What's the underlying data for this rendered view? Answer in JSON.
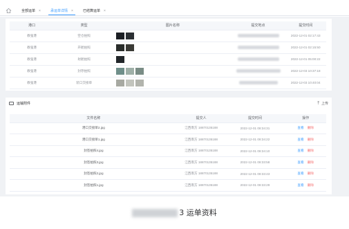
{
  "tabs": [
    {
      "label": "全部运单"
    },
    {
      "label": "承运单详情"
    },
    {
      "label": "已结算运单"
    }
  ],
  "tab_close": "×",
  "table1": {
    "headers": [
      "港口",
      "类型",
      "图片名称",
      "提交地点",
      "提交时间"
    ],
    "rows": [
      {
        "port": "教强港",
        "type": "空仓拍照",
        "thumbs": [
          "#1c1f24",
          "#2b2f33"
        ],
        "time": "2022-12-01 02:17:43"
      },
      {
        "port": "教强港",
        "type": "开舱拍照",
        "thumbs": [
          "#2a2d2b",
          "#3a3a36"
        ],
        "time": "2022-12-01 02:15:50"
      },
      {
        "port": "教强港",
        "type": "射舱拍照",
        "thumbs": [
          "#22262a"
        ],
        "time": "2022-12-01 05:00:22"
      },
      {
        "port": "教强港",
        "type": "封存拍照",
        "thumbs": [
          "#6f8f8a",
          "#9fb0a8",
          "#7a8d86"
        ],
        "time": "2022-12-03 10:37:18"
      },
      {
        "port": "教强港",
        "type": "装口交接单",
        "thumbs": [
          "#a7a9a2",
          "#c2c4bd",
          "#b2b4ad"
        ],
        "time": "2022-12-03 10:40:04"
      }
    ]
  },
  "attachments": {
    "title": "运输附件",
    "upload_label": "上传",
    "headers": [
      "文件名称",
      "提交人",
      "提交时间",
      "操作"
    ],
    "view_label": "查看",
    "delete_label": "删除",
    "rows": [
      {
        "file": "港口交接单2.jpg",
        "submitter": "江西南方 18870135188",
        "time": "2022-12-01 08:34:31"
      },
      {
        "file": "港口交接单1.jpg",
        "submitter": "江西南方 18870135188",
        "time": "2022-12-01 08:34:22"
      },
      {
        "file": "封签拍照4.jpg",
        "submitter": "江西南方 18870135188",
        "time": "2022-12-01 08:34:10"
      },
      {
        "file": "封签拍照3.jpg",
        "submitter": "江西南方 18870135188",
        "time": "2022-12-01 08:33:58"
      },
      {
        "file": "封签拍照2.jpg",
        "submitter": "江西南方 18870135188",
        "time": "2022-12-01 08:33:43"
      },
      {
        "file": "封签拍照1.jpg",
        "submitter": "江西南方 18870135188",
        "time": "2022-12-01 08:33:29"
      }
    ]
  },
  "caption": {
    "text": "3 运单资料"
  }
}
